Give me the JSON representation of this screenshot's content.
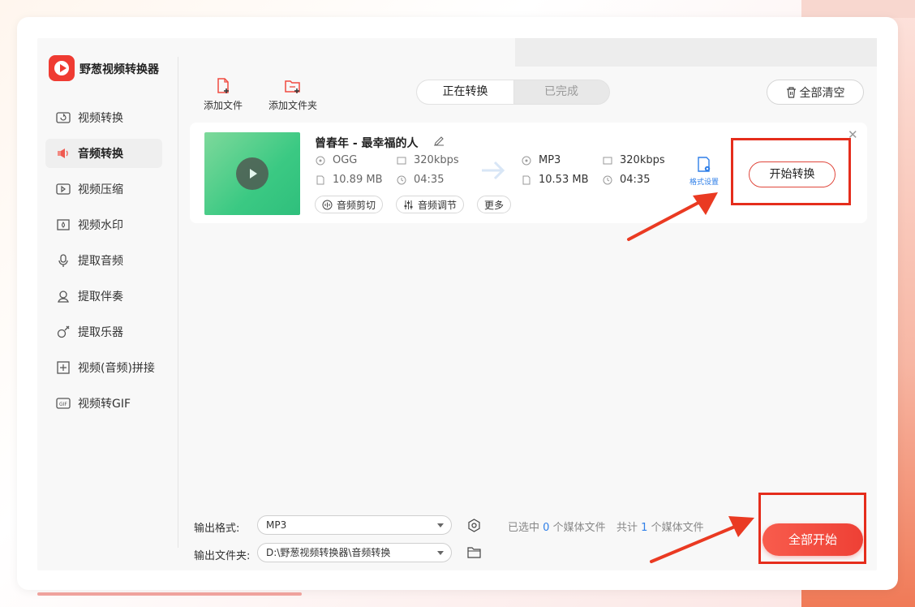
{
  "app": {
    "title": "野葱视频转换器"
  },
  "sidebar": {
    "items": [
      {
        "label": "视频转换",
        "icon": "video-convert-icon"
      },
      {
        "label": "音频转换",
        "icon": "speaker-icon",
        "active": true
      },
      {
        "label": "视频压缩",
        "icon": "compress-icon"
      },
      {
        "label": "视频水印",
        "icon": "watermark-icon"
      },
      {
        "label": "提取音频",
        "icon": "mic-icon"
      },
      {
        "label": "提取伴奏",
        "icon": "accompaniment-icon"
      },
      {
        "label": "提取乐器",
        "icon": "guitar-icon"
      },
      {
        "label": "视频(音频)拼接",
        "icon": "merge-icon"
      },
      {
        "label": "视频转GIF",
        "icon": "gif-icon"
      }
    ]
  },
  "toolbar": {
    "add_file": "添加文件",
    "add_folder": "添加文件夹",
    "tabs": [
      "正在转换",
      "已完成"
    ],
    "clear_all": "全部清空"
  },
  "file": {
    "title": "曾春年 - 最幸福的人",
    "input": {
      "format": "OGG",
      "bitrate": "320kbps",
      "size": "10.89 MB",
      "duration": "04:35"
    },
    "output": {
      "format": "MP3",
      "bitrate": "320kbps",
      "size": "10.53 MB",
      "duration": "04:35"
    },
    "actions": {
      "cut": "音频剪切",
      "adjust": "音频调节",
      "more": "更多"
    },
    "format_settings": "格式设置",
    "start": "开始转换"
  },
  "bottom": {
    "output_format_label": "输出格式:",
    "output_format_value": "MP3",
    "output_folder_label": "输出文件夹:",
    "output_folder_value": "D:\\野葱视频转换器\\音频转换",
    "selected_prefix": "已选中",
    "selected_count": "0",
    "selected_suffix": "个媒体文件",
    "total_prefix": "共计",
    "total_count": "1",
    "total_suffix": "个媒体文件",
    "start_all": "全部开始"
  },
  "colors": {
    "accent": "#ef3b32",
    "link": "#2f7fe8",
    "highlight": "#e52d1c"
  }
}
